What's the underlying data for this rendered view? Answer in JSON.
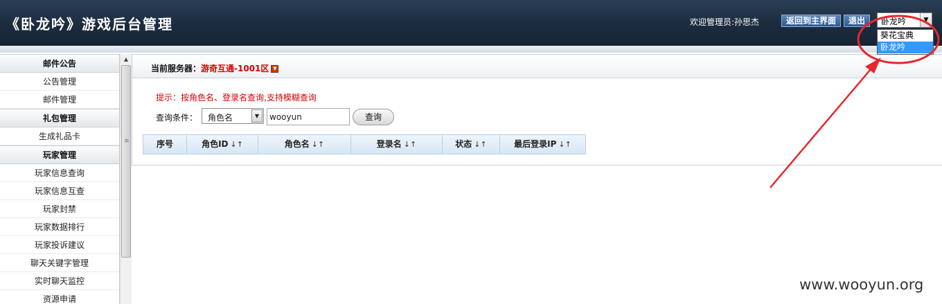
{
  "header": {
    "title": "《卧龙吟》游戏后台管理",
    "welcome": "欢迎管理员:孙思杰",
    "back_main_label": "返回到主界面",
    "logout_label": "退出",
    "game_select_value": "卧龙吟",
    "game_options": [
      "葵花宝典",
      "卧龙吟"
    ],
    "game_selected_index": 1
  },
  "sidebar": {
    "sections": [
      {
        "title": "邮件公告",
        "items": [
          "公告管理",
          "邮件管理"
        ]
      },
      {
        "title": "礼包管理",
        "items": [
          "生成礼品卡"
        ]
      },
      {
        "title": "玩家管理",
        "items": [
          "玩家信息查询",
          "玩家信息互查",
          "玩家封禁",
          "玩家数据排行",
          "玩家投诉建议",
          "聊天关键字管理",
          "实时聊天监控",
          "资源申请"
        ]
      }
    ]
  },
  "main": {
    "server_label": "当前服务器：",
    "server_name": "游奇互通-1001区",
    "hint": "提示：按角色名、登录名查询,支持模糊查询",
    "query_label": "查询条件：",
    "query_select_value": "角色名",
    "query_input_value": "wooyun",
    "query_button": "查询",
    "table_columns": [
      "序号",
      "角色ID",
      "角色名",
      "登录名",
      "状态",
      "最后登录IP"
    ],
    "sort_glyph": "↓↑"
  },
  "watermark": "www.wooyun.org",
  "colors": {
    "header_bg": "#1c2c3e",
    "accent_red": "#d40000",
    "annotation_red": "#e8262c",
    "dropdown_selected": "#3399ff"
  }
}
